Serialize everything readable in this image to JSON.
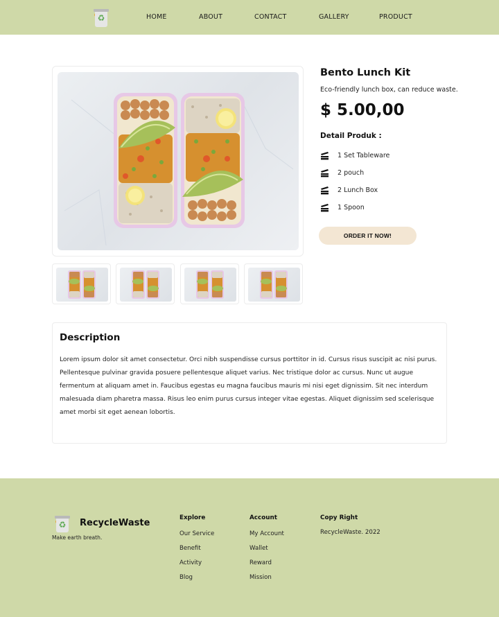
{
  "nav": {
    "logo_icon": "recycle-bin-icon",
    "links": [
      "HOME",
      "ABOUT",
      "CONTACT",
      "GALLERY",
      "PRODUCT"
    ]
  },
  "product": {
    "title": "Bento Lunch Kit",
    "subtitle": "Eco-friendly lunch box, can reduce waste.",
    "price": "$ 5.00,00",
    "detail_heading": "Detail Produk :",
    "details": [
      {
        "icon": "tableware-icon",
        "text": "1 Set Tableware"
      },
      {
        "icon": "tableware-icon",
        "text": "2 pouch"
      },
      {
        "icon": "tableware-icon",
        "text": "2 Lunch Box"
      },
      {
        "icon": "tableware-icon",
        "text": "1 Spoon"
      }
    ],
    "order_label": "ORDER IT NOW!"
  },
  "description": {
    "title": "Description",
    "body": "Lorem ipsum dolor sit amet consectetur. Orci nibh suspendisse cursus porttitor in id. Cursus risus suscipit ac nisi purus. Pellentesque pulvinar gravida posuere pellentesque aliquet varius. Nec tristique dolor ac cursus. Nunc ut augue fermentum at aliquam amet in. Faucibus egestas eu magna faucibus mauris mi nisi eget dignissim. Sit nec interdum malesuada diam pharetra massa. Risus leo enim purus cursus integer vitae egestas. Aliquet dignissim sed scelerisque amet morbi sit eget aenean lobortis."
  },
  "footer": {
    "brand": "RecycleWaste",
    "tagline": "Make earth breath.",
    "explore": {
      "heading": "Explore",
      "links": [
        "Our Service",
        "Benefit",
        "Activity",
        "Blog"
      ]
    },
    "account": {
      "heading": "Account",
      "links": [
        "My Account",
        "Wallet",
        "Reward",
        "Mission"
      ]
    },
    "copyright": {
      "heading": "Copy Right",
      "text": "RecycleWaste. 2022"
    }
  },
  "colors": {
    "header_footer_bg": "#cfd9a8",
    "order_button_bg": "#f3e6d3"
  }
}
